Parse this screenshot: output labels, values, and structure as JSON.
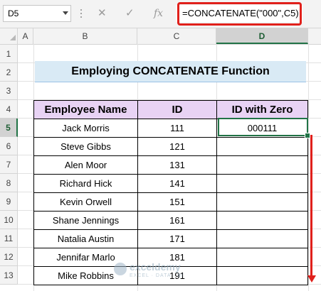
{
  "namebox": {
    "value": "D5"
  },
  "formula_bar": {
    "cancel_icon": "✕",
    "enter_icon": "✓",
    "fx_icon": "fx",
    "formula": "=CONCATENATE(\"000\",C5)"
  },
  "columns": [
    "A",
    "B",
    "C",
    "D"
  ],
  "rows": [
    "1",
    "2",
    "3",
    "4",
    "5",
    "6",
    "7",
    "8",
    "9",
    "10",
    "11",
    "12",
    "13"
  ],
  "sheet": {
    "title": "Employing CONCATENATE Function",
    "headers": [
      "Employee Name",
      "ID",
      "ID with Zero"
    ],
    "records": [
      {
        "name": "Jack Morris",
        "id": "111",
        "zero": "000111"
      },
      {
        "name": "Steve Gibbs",
        "id": "121",
        "zero": ""
      },
      {
        "name": "Alen Moor",
        "id": "131",
        "zero": ""
      },
      {
        "name": "Richard Hick",
        "id": "141",
        "zero": ""
      },
      {
        "name": "Kevin Orwell",
        "id": "151",
        "zero": ""
      },
      {
        "name": "Shane Jennings",
        "id": "161",
        "zero": ""
      },
      {
        "name": "Natalia Austin",
        "id": "171",
        "zero": ""
      },
      {
        "name": "Jennifar Marlo",
        "id": "181",
        "zero": ""
      },
      {
        "name": "Mike Robbins",
        "id": "191",
        "zero": ""
      }
    ]
  },
  "watermark": {
    "brand": "exceldemy",
    "tagline": "EXCEL · DATA · BI"
  },
  "colors": {
    "accent": "#217346",
    "highlight": "#e0201b",
    "header_fill": "#e8d3f4",
    "title_fill": "#d9eaf5"
  }
}
